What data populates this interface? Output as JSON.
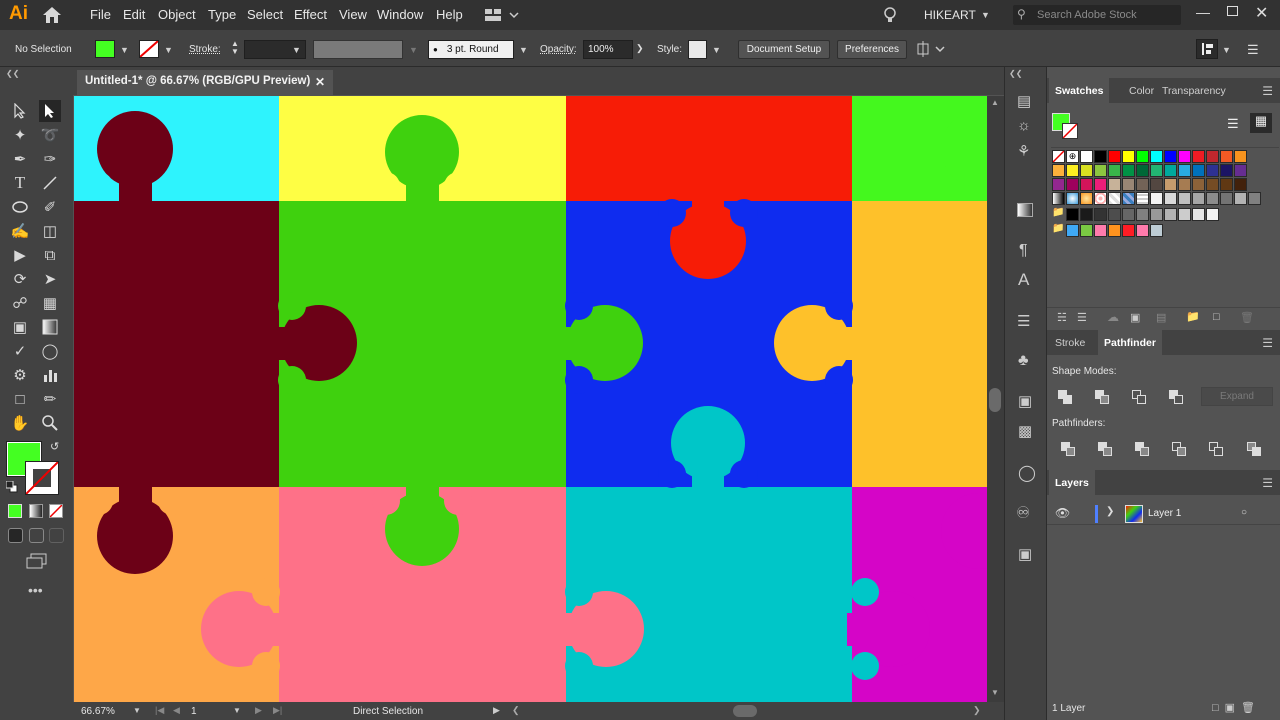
{
  "app": {
    "logo": "Ai",
    "user": "HIKEART",
    "search_placeholder": "Search Adobe Stock"
  },
  "menus": [
    "File",
    "Edit",
    "Object",
    "Type",
    "Select",
    "Effect",
    "View",
    "Window",
    "Help"
  ],
  "control": {
    "selection_status": "No Selection",
    "stroke_label": "Stroke:",
    "brush_value": "3 pt. Round",
    "opacity_label": "Opacity:",
    "opacity_value": "100%",
    "style_label": "Style:",
    "document_setup": "Document Setup",
    "preferences": "Preferences"
  },
  "document": {
    "tab_title": "Untitled-1* @ 66.67% (RGB/GPU Preview)"
  },
  "status": {
    "zoom": "66.67%",
    "artboard": "1",
    "tool": "Direct Selection"
  },
  "colors": {
    "fill": "#44ff22",
    "puzzle": {
      "cyan": "#2ef3fd",
      "yellow": "#fefe44",
      "red": "#f71c06",
      "lime": "#44f81e",
      "maroon": "#6c0117",
      "green": "#3fd10e",
      "blue": "#0f2cef",
      "amber": "#fec12a",
      "orange": "#fea748",
      "pink": "#fe7188",
      "teal": "#00c6c8",
      "magenta": "#d505c7"
    }
  },
  "panels": {
    "swatches_tab": "Swatches",
    "color_tab": "Color",
    "transparency_tab": "Transparency",
    "stroke_tab": "Stroke",
    "pathfinder_tab": "Pathfinder",
    "shape_modes": "Shape Modes:",
    "expand": "Expand",
    "pathfinders": "Pathfinders:",
    "layers_tab": "Layers",
    "layer_name": "Layer 1",
    "layer_count": "1 Layer"
  },
  "swatches": {
    "row1": [
      "#ffffff",
      "#000000",
      "#ff0000",
      "#ffff00",
      "#00ff00",
      "#00ffff",
      "#0000ff",
      "#ff00ff",
      "#ed1c24",
      "#c1272d",
      "#f15a24",
      "#f7931e"
    ],
    "row2": [
      "#fbb03b",
      "#fcee21",
      "#d9e021",
      "#8cc63f",
      "#39b54a",
      "#009245",
      "#006837",
      "#22b573",
      "#00a99d",
      "#29abe2",
      "#0071bc",
      "#2e3192",
      "#1b1464",
      "#662d91"
    ],
    "row3": [
      "#93278f",
      "#9e005d",
      "#d4145a",
      "#ed1e79",
      "#c7b299",
      "#998675",
      "#736357",
      "#534741",
      "#c69c6d",
      "#a67c52",
      "#8c6239",
      "#754c24",
      "#603813",
      "#42210b"
    ],
    "row4": [
      "#f2f2f2",
      "#d9d9d9",
      "#bfbfbf",
      "#a6a6a6",
      "#8c8c8c",
      "#737373",
      "#b3b3b3",
      "#808080"
    ],
    "row5": [
      "#000000",
      "#1a1a1a",
      "#333333",
      "#4d4d4d",
      "#666666",
      "#808080",
      "#999999",
      "#b3b3b3",
      "#cccccc",
      "#e6e6e6",
      "#f2f2f2"
    ],
    "row6": [
      "#3fa9f5",
      "#7ac943",
      "#ff7bac",
      "#ff931e",
      "#ff1d25",
      "#ff7bac",
      "#bdccd4"
    ]
  }
}
